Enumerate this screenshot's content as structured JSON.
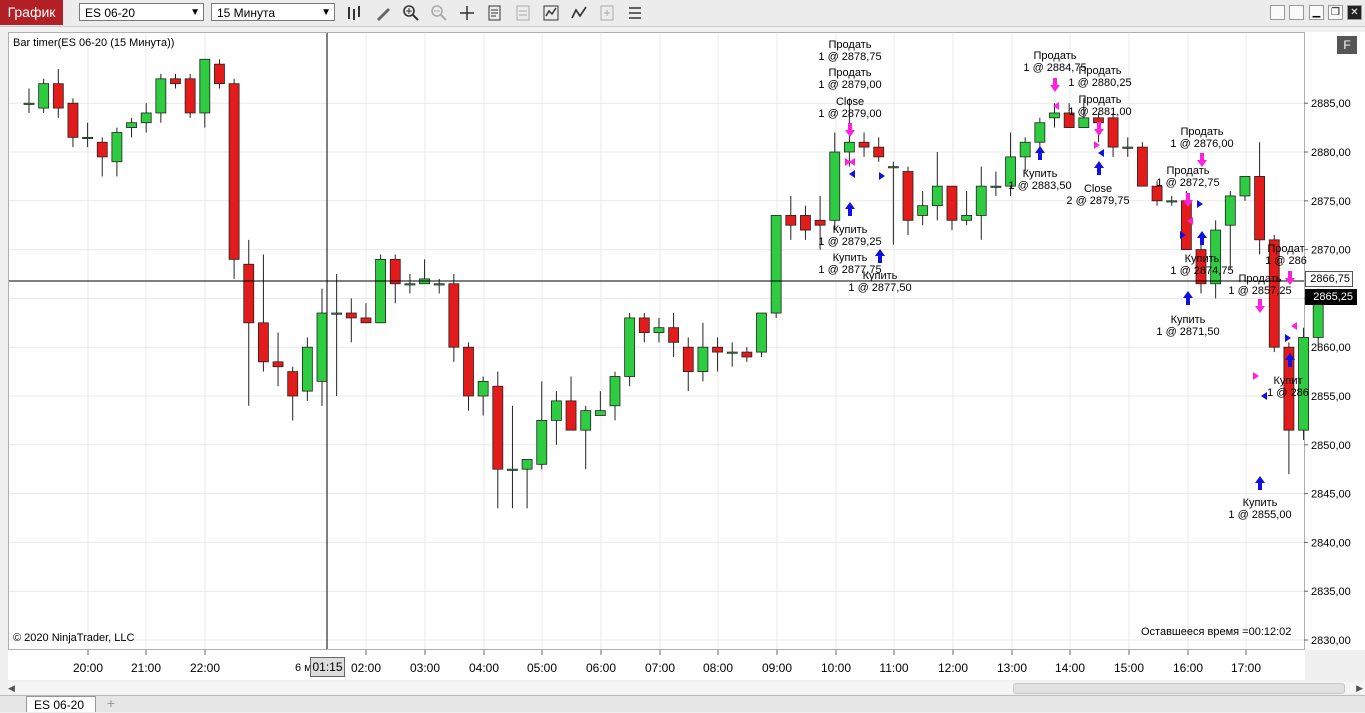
{
  "toolbar": {
    "title": "График",
    "instrument": "ES 06-20",
    "timeframe": "15 Минута",
    "icons": [
      "bar-type-icon",
      "draw-tool-icon",
      "zoom-in-icon",
      "zoom-out-icon",
      "crosshair-icon",
      "properties-icon",
      "data-box-icon",
      "strategies-icon",
      "indicators-icon",
      "templates-icon",
      "chart-trader-icon"
    ]
  },
  "chart": {
    "indicator_label": "Bar timer(ES 06-20 (15 Минута))",
    "copyright": "© 2020 NinjaTrader, LLC",
    "remaining_time": "Оставшееся время =00:12:02",
    "crosshair_time": "01:15",
    "crosshair_date_fragment": "6 м",
    "crosshair_price": "2866,75",
    "last_price": "2865,25",
    "f_button": "F",
    "colors": {
      "up": "#2ecc40",
      "down": "#e31b1b",
      "buy_arrow": "#1010e0",
      "sell_arrow": "#ff22dd"
    }
  },
  "chart_data": {
    "type": "candlestick",
    "ylim": [
      2828,
      2892
    ],
    "y_ticks": [
      "2885,00",
      "2880,00",
      "2875,00",
      "2870,00",
      "2865,00",
      "2860,00",
      "2855,00",
      "2850,00",
      "2845,00",
      "2840,00",
      "2835,00",
      "2830,00"
    ],
    "x_ticks": [
      "20:00",
      "21:00",
      "22:00",
      "02:00",
      "03:00",
      "04:00",
      "05:00",
      "06:00",
      "07:00",
      "08:00",
      "09:00",
      "10:00",
      "11:00",
      "12:00",
      "13:00",
      "14:00",
      "15:00",
      "16:00",
      "17:00"
    ],
    "candles": [
      [
        2885,
        2886.5,
        2884,
        2885
      ],
      [
        2884.5,
        2887.5,
        2884,
        2887
      ],
      [
        2887,
        2888.5,
        2883.5,
        2884.5
      ],
      [
        2885,
        2885.5,
        2880.5,
        2881.5
      ],
      [
        2881.5,
        2883,
        2880.5,
        2881.5
      ],
      [
        2881,
        2881.5,
        2877.5,
        2879.5
      ],
      [
        2879,
        2882.5,
        2877.5,
        2882
      ],
      [
        2882.5,
        2883.5,
        2881.5,
        2883
      ],
      [
        2883,
        2885,
        2882,
        2884
      ],
      [
        2884,
        2888,
        2883,
        2887.5
      ],
      [
        2887.5,
        2888,
        2886.5,
        2887
      ],
      [
        2887.5,
        2888,
        2883.5,
        2884
      ],
      [
        2884,
        2889.5,
        2882.5,
        2889.5
      ],
      [
        2889,
        2889.5,
        2886.5,
        2887
      ],
      [
        2887,
        2887.5,
        2867,
        2869
      ],
      [
        2868.5,
        2871,
        2854,
        2862.5
      ],
      [
        2862.5,
        2869.5,
        2857.5,
        2858.5
      ],
      [
        2858.5,
        2861.5,
        2856,
        2858
      ],
      [
        2857.5,
        2858,
        2852.5,
        2855
      ],
      [
        2855.5,
        2861,
        2854.5,
        2860
      ],
      [
        2856.5,
        2866,
        2854,
        2863.5
      ],
      [
        2863.5,
        2867.5,
        2855,
        2863.5
      ],
      [
        2863.5,
        2865,
        2860.5,
        2863
      ],
      [
        2863,
        2864.5,
        2862.5,
        2862.5
      ],
      [
        2862.5,
        2869.5,
        2862.5,
        2869
      ],
      [
        2869,
        2869.5,
        2864.5,
        2866.5
      ],
      [
        2866.5,
        2867.5,
        2865.5,
        2866.5
      ],
      [
        2866.5,
        2869,
        2866.5,
        2867
      ],
      [
        2866.5,
        2867,
        2865.5,
        2866.5
      ],
      [
        2866.5,
        2867.5,
        2858.5,
        2860
      ],
      [
        2860,
        2860.5,
        2853.5,
        2855
      ],
      [
        2855,
        2857,
        2853,
        2856.5
      ],
      [
        2856,
        2857.5,
        2843.5,
        2847.5
      ],
      [
        2847.5,
        2854,
        2843.5,
        2847.5
      ],
      [
        2847.5,
        2848.5,
        2843.5,
        2848.5
      ],
      [
        2848,
        2856.5,
        2847.5,
        2852.5
      ],
      [
        2852.5,
        2855.5,
        2850,
        2854.5
      ],
      [
        2854.5,
        2857,
        2851.5,
        2851.5
      ],
      [
        2851.5,
        2854,
        2847.5,
        2853.5
      ],
      [
        2853,
        2855.5,
        2853,
        2853.5
      ],
      [
        2854,
        2857.5,
        2852.5,
        2857
      ],
      [
        2857,
        2863.5,
        2856,
        2863
      ],
      [
        2863,
        2863.5,
        2860.5,
        2861.5
      ],
      [
        2861.5,
        2863,
        2860.5,
        2862
      ],
      [
        2862,
        2863.5,
        2859,
        2860.5
      ],
      [
        2860,
        2861,
        2855.5,
        2857.5
      ],
      [
        2857.5,
        2862.5,
        2856.5,
        2860
      ],
      [
        2860,
        2861,
        2857.5,
        2859.5
      ],
      [
        2859.5,
        2860.5,
        2858,
        2859.5
      ],
      [
        2859.5,
        2860,
        2858.5,
        2859
      ],
      [
        2859.5,
        2863.5,
        2859,
        2863.5
      ],
      [
        2863.5,
        2873.5,
        2863,
        2873.5
      ],
      [
        2873.5,
        2875.5,
        2871,
        2872.5
      ],
      [
        2873.5,
        2874.5,
        2871,
        2872
      ],
      [
        2873,
        2875.5,
        2870,
        2872.5
      ],
      [
        2873,
        2882,
        2872,
        2880
      ],
      [
        2880,
        2885.5,
        2878.5,
        2881
      ],
      [
        2881,
        2882,
        2879.5,
        2880.5
      ],
      [
        2880.5,
        2881.5,
        2879,
        2879.5
      ],
      [
        2878.5,
        2879,
        2870.5,
        2878.5
      ],
      [
        2878,
        2878.5,
        2871.5,
        2873
      ],
      [
        2873.5,
        2876,
        2872.5,
        2874.5
      ],
      [
        2874.5,
        2880,
        2873,
        2876.5
      ],
      [
        2876.5,
        2876.5,
        2872,
        2873
      ],
      [
        2873,
        2876,
        2872.5,
        2873.5
      ],
      [
        2873.5,
        2878.5,
        2871,
        2876.5
      ],
      [
        2876.5,
        2878,
        2875.5,
        2876.5
      ],
      [
        2876.5,
        2882,
        2875.5,
        2879.5
      ],
      [
        2879.5,
        2881.5,
        2878,
        2881
      ],
      [
        2881,
        2883.5,
        2879.5,
        2883
      ],
      [
        2883.5,
        2885,
        2882.5,
        2884
      ],
      [
        2884,
        2885,
        2882.5,
        2882.5
      ],
      [
        2882.5,
        2885.5,
        2882.5,
        2883.5
      ],
      [
        2883.5,
        2884,
        2881,
        2883
      ],
      [
        2883.5,
        2884,
        2879.5,
        2880.5
      ],
      [
        2880.5,
        2881.5,
        2879.5,
        2880.5
      ],
      [
        2880.5,
        2881,
        2876.5,
        2876.5
      ],
      [
        2876.5,
        2877,
        2874.5,
        2875
      ],
      [
        2875,
        2875.5,
        2874.5,
        2875
      ],
      [
        2875,
        2876,
        2870,
        2870
      ],
      [
        2870,
        2871.5,
        2865.5,
        2866.5
      ],
      [
        2866.5,
        2873,
        2865,
        2872
      ],
      [
        2872.5,
        2876,
        2868,
        2875.5
      ],
      [
        2875.5,
        2877.5,
        2875,
        2877.5
      ],
      [
        2877.5,
        2881,
        2869.5,
        2871
      ],
      [
        2871,
        2871.5,
        2859.5,
        2860
      ],
      [
        2860,
        2860.5,
        2847,
        2851.5
      ],
      [
        2851.5,
        2862,
        2850.5,
        2861
      ],
      [
        2861,
        2866,
        2860,
        2865
      ]
    ],
    "annotations": [
      {
        "text": "Продать",
        "text2": "1 @ 2878,75"
      },
      {
        "text": "Продать",
        "text2": "1 @ 2879,00"
      },
      {
        "text": "Close",
        "text2": "1 @ 2879,00"
      },
      {
        "text": "Купить",
        "text2": "1 @ 2879,25"
      },
      {
        "text": "Купить",
        "text2": "1 @ 2877,75"
      },
      {
        "text": "Купить",
        "text2": "1 @ 2877,50"
      },
      {
        "text": "Продать",
        "text2": "1 @ 2884,75"
      },
      {
        "text": "Продать",
        "text2": "1 @ 2880,25"
      },
      {
        "text": "Продать",
        "text2": "1 @ 2881,00"
      },
      {
        "text": "Купить",
        "text2": "1 @ 2883,50"
      },
      {
        "text": "Close",
        "text2": "2 @ 2879,75"
      },
      {
        "text": "Продать",
        "text2": "1 @ 2876,00"
      },
      {
        "text": "Продать",
        "text2": "1 @ 2872,75"
      },
      {
        "text": "Купить",
        "text2": "1 @ 2874,75"
      },
      {
        "text": "Купить",
        "text2": "1 @ 2871,50"
      },
      {
        "text": "Продать",
        "text2": "1 @ 2857,25"
      },
      {
        "text": "Продат",
        "text2": "1 @ 286"
      },
      {
        "text": "Купить",
        "text2": "1 @ 2855,00"
      },
      {
        "text": "Купит",
        "text2": "1 @ 286"
      }
    ]
  },
  "tabs": {
    "active": "ES 06-20",
    "add": "+"
  }
}
